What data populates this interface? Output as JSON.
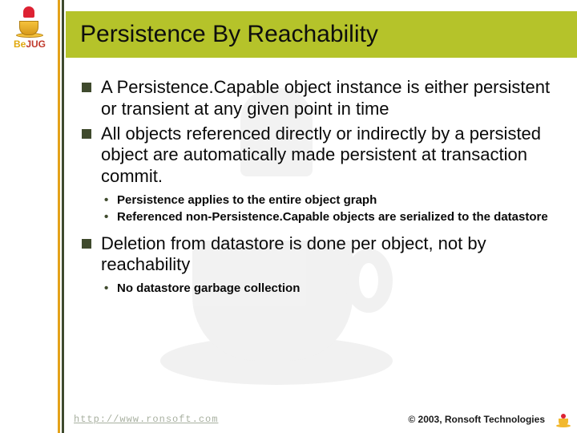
{
  "logo": {
    "name_prefix": "Be",
    "name_suffix": "JUG"
  },
  "title": "Persistence By Reachability",
  "bullets": [
    {
      "text": "A Persistence.Capable object instance is either persistent or transient at any given point in time",
      "sub": []
    },
    {
      "text": "All objects referenced directly or indirectly by a persisted object are automatically made persistent at transaction commit.",
      "sub": [
        "Persistence applies to the entire object graph",
        "Referenced non-Persistence.Capable objects are serialized to the datastore"
      ]
    },
    {
      "text": "Deletion from datastore is done per object, not by reachability",
      "sub": [
        "No datastore garbage collection"
      ]
    }
  ],
  "footer": {
    "url": "http://www.ronsoft.com",
    "copyright": "© 2003, Ronsoft Technologies"
  }
}
